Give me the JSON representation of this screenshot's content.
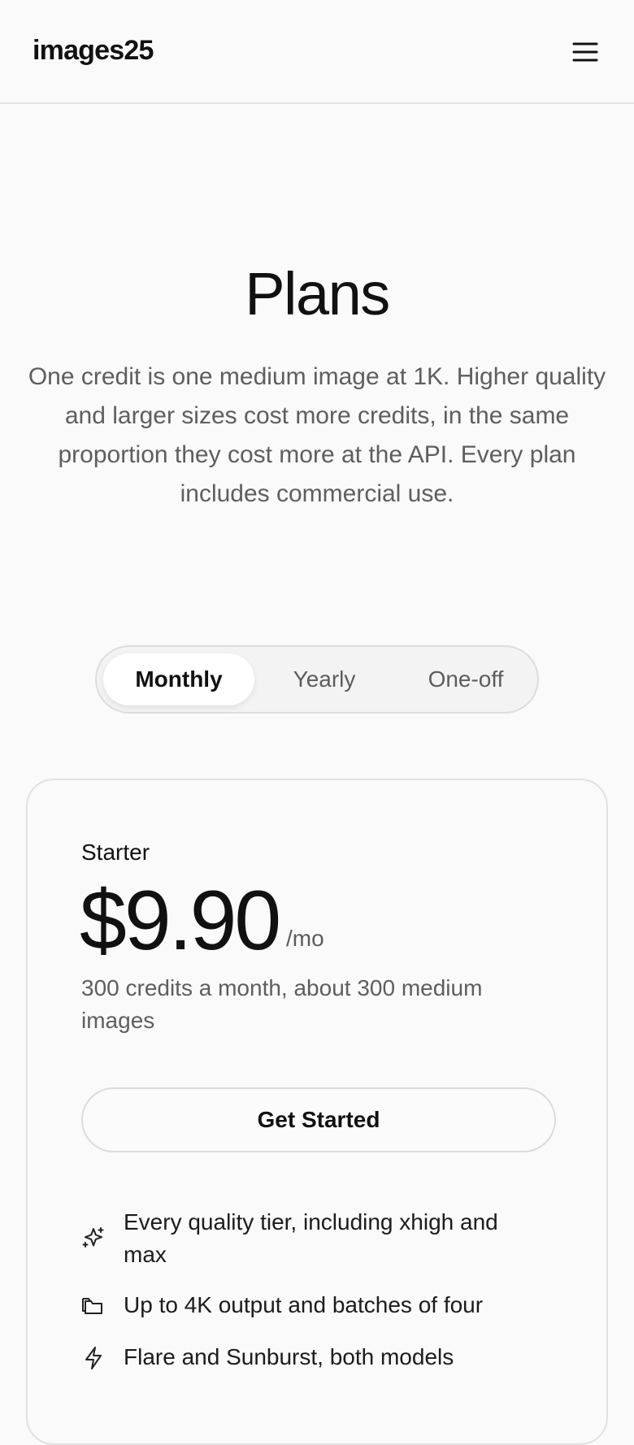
{
  "header": {
    "logo": "images25",
    "menu_icon": "hamburger-menu-icon"
  },
  "hero": {
    "title": "Plans",
    "description": "One credit is one medium image at 1K. Higher quality and larger sizes cost more credits, in the same proportion they cost more at the API. Every plan includes commercial use."
  },
  "billing_toggle": {
    "selected": "Monthly",
    "options": [
      "Monthly",
      "Yearly",
      "One-off"
    ]
  },
  "plan": {
    "name": "Starter",
    "price": "$9.90",
    "period": "/mo",
    "credits_description": "300 credits a month, about 300 medium images",
    "cta_label": "Get Started",
    "features": [
      {
        "icon": "sparkles-icon",
        "text": "Every quality tier, including xhigh and max"
      },
      {
        "icon": "stacked-images-icon",
        "text": "Up to 4K output and batches of four"
      },
      {
        "icon": "lightning-icon",
        "text": "Flare and Sunburst, both models"
      }
    ]
  },
  "colors": {
    "background": "#fafafa",
    "text": "#111111",
    "muted_text": "#5e5e5e",
    "border": "#e1e1e1",
    "toggle_background": "#f3f3f3",
    "active_toggle": "#ffffff"
  }
}
